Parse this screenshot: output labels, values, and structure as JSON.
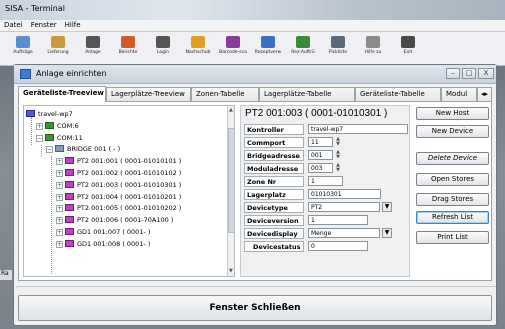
{
  "app_title": "SISA - Terminal",
  "menu": [
    "Datei",
    "Fenster",
    "Hilfe"
  ],
  "toolbar": [
    {
      "label": "Aufträge",
      "icon": "orders-icon",
      "color": "#5a8fcf"
    },
    {
      "label": "Lieferung",
      "icon": "delivery-icon",
      "color": "#c89a3a"
    },
    {
      "label": "Anlage",
      "icon": "key-icon",
      "color": "#555555"
    },
    {
      "label": "Berichte",
      "icon": "reports-icon",
      "color": "#d45a2a"
    },
    {
      "label": "Login",
      "icon": "login-icon",
      "color": "#555555"
    },
    {
      "label": "Nachschub",
      "icon": "replenish-icon",
      "color": "#e0a020"
    },
    {
      "label": "Barcode-sca",
      "icon": "barcode-icon",
      "color": "#8a3a9a"
    },
    {
      "label": "Rezeptverw",
      "icon": "recipe-icon",
      "color": "#3a70c0"
    },
    {
      "label": "Rez-Auftrü",
      "icon": "recipe-order-icon",
      "color": "#3a8a3a"
    },
    {
      "label": "Pickliste",
      "icon": "picklist-icon",
      "color": "#5a6a7a"
    },
    {
      "label": "Hilfe zu",
      "icon": "help-icon",
      "color": "#8a8a8a"
    },
    {
      "label": "Exit",
      "icon": "exit-icon",
      "color": "#4a4a4a"
    }
  ],
  "dialog": {
    "title": "Anlage einrichten",
    "window_buttons": [
      "–",
      "□",
      "X"
    ],
    "tabs": [
      "Geräteliste-Treeview",
      "Lagerplätze-Treeview",
      "Zonen-Tabelle",
      "Lagerplätze-Tabelle",
      "Geräteliste-Tabelle",
      "Modul"
    ],
    "active_tab": "Geräteliste-Treeview",
    "tree": [
      {
        "label": "travel-wp7",
        "icon": "pc-icon",
        "level": 0
      },
      {
        "label": "COM:6",
        "icon": "com-icon",
        "level": 1,
        "exp": "+"
      },
      {
        "label": "COM:11",
        "icon": "com-icon",
        "level": 1,
        "exp": "−"
      },
      {
        "label": "BRIDGE 001 ( - )",
        "icon": "bridge-icon",
        "level": 2,
        "exp": "−"
      },
      {
        "label": "PT2 001:001 ( 0001-01010101 )",
        "icon": "pt-icon",
        "level": 3,
        "exp": "+"
      },
      {
        "label": "PT2 001:002 ( 0001-01010102 )",
        "icon": "pt-icon",
        "level": 3,
        "exp": "+"
      },
      {
        "label": "PT2 001:003 ( 0001-01010301 )",
        "icon": "pt-icon",
        "level": 3,
        "exp": "+"
      },
      {
        "label": "PT2 001:004 ( 0001-01010201 )",
        "icon": "pt-icon",
        "level": 3,
        "exp": "+"
      },
      {
        "label": "PT2 001:005 ( 0001-01010202 )",
        "icon": "pt-icon",
        "level": 3,
        "exp": "+"
      },
      {
        "label": "PT2 001:006 ( 0001-70A100 )",
        "icon": "pt-icon",
        "level": 3,
        "exp": "+"
      },
      {
        "label": "GD1 001:007 ( 0001- )",
        "icon": "pt-icon",
        "level": 3,
        "exp": "+"
      },
      {
        "label": "GD1 001:008 ( 0001- )",
        "icon": "pt-icon",
        "level": 3,
        "exp": "+"
      }
    ],
    "detail": {
      "title": "PT2 001:003 ( 0001-01010301 )",
      "kontroller_label": "Kontroller",
      "kontroller": "travel-wp7",
      "commport_label": "Commport",
      "commport": "11",
      "bridgeadresse_label": "Bridgeadresse",
      "bridgeadresse": "001",
      "moduladresse_label": "Moduladresse",
      "moduladresse": "003",
      "zone_label": "Zone Nr",
      "zone": "1",
      "lagerplatz_label": "Lagerplatz",
      "lagerplatz": "01010301",
      "devicetype_label": "Devicetype",
      "devicetype": "PT2",
      "deviceversion_label": "Deviceversion",
      "deviceversion": "1",
      "devicedisplay_label": "Devicedisplay",
      "devicedisplay": "Menge",
      "devicestatus_label": "Devicestatus",
      "devicestatus": "0"
    },
    "buttons": {
      "new_host": "New Host",
      "new_device": "New Device",
      "delete_device": "Delete Device",
      "open_stores": "Open Stores",
      "drag_stores": "Drag Stores",
      "refresh_list": "Refresh List",
      "print_list": "Print List"
    },
    "close_label": "Fenster Schließen"
  },
  "background_label": "Ra"
}
